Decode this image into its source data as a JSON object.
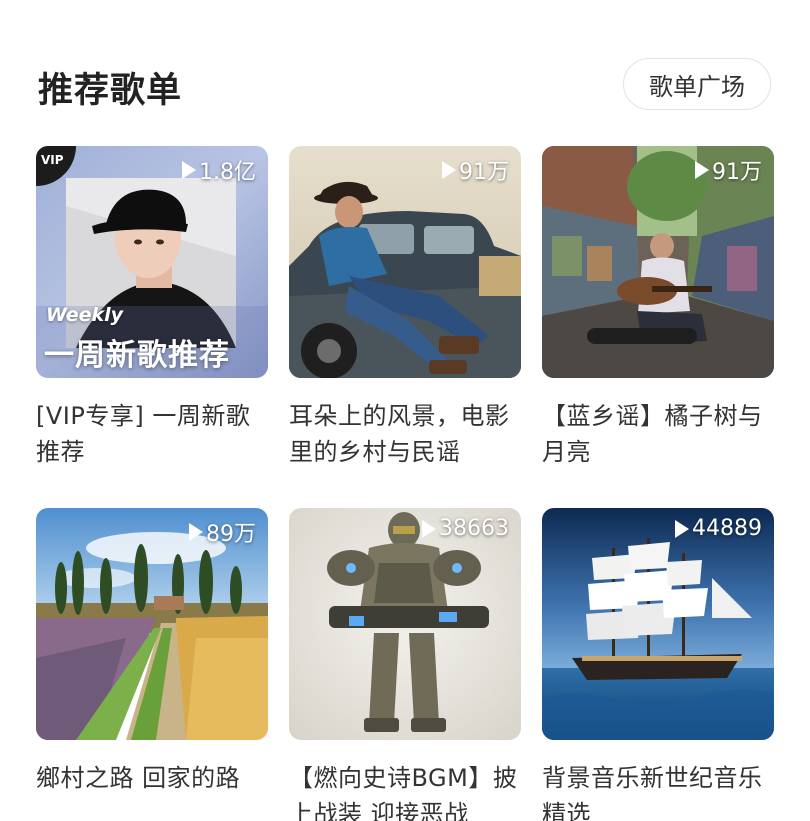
{
  "section": {
    "title": "推荐歌单",
    "more_button": "歌单广场"
  },
  "playlists": [
    {
      "title": "[VIP专享] 一周新歌推荐",
      "play_count": "1.8亿",
      "vip_badge": "VIP",
      "cover_text_line1": "Weekly",
      "cover_text_line2": "一周新歌推荐"
    },
    {
      "title": "耳朵上的风景，电影里的乡村与民谣",
      "play_count": "91万"
    },
    {
      "title": "【蓝乡谣】橘子树与月亮",
      "play_count": "91万"
    },
    {
      "title": "鄉村之路 回家的路",
      "play_count": "89万"
    },
    {
      "title": "【燃向史诗BGM】披上战装 迎接恶战",
      "play_count": "38663"
    },
    {
      "title": "背景音乐新世纪音乐精选",
      "play_count": "44889"
    }
  ],
  "icons": {
    "play": "play-triangle-icon"
  }
}
